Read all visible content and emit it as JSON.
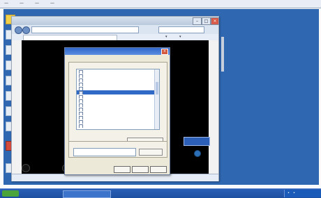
{
  "host": {
    "menu_items": [
      "—",
      "—",
      "—",
      "—"
    ]
  },
  "browser": {
    "title": "",
    "address": "",
    "search_placeholder": "",
    "tab_label": "",
    "status": "",
    "zoom": ""
  },
  "dialog": {
    "title": "",
    "tabs": [
      "",
      "",
      "",
      "",
      ""
    ],
    "group_label": "",
    "list_items": [
      "",
      "",
      "",
      "",
      "",
      "",
      "",
      "",
      "",
      "",
      "",
      "",
      "",
      ""
    ],
    "selected_index": 5,
    "note": "",
    "restore_label": "",
    "reset_text": "",
    "reset_label": "",
    "ok_label": "",
    "cancel_label": "",
    "apply_label": ""
  },
  "taskbar": {
    "start_label": "",
    "task_label": "",
    "clock": ""
  },
  "colors": {
    "desktop": "#2f67b1",
    "selection": "#3169c6",
    "dialog_title": "#2f66c9"
  }
}
